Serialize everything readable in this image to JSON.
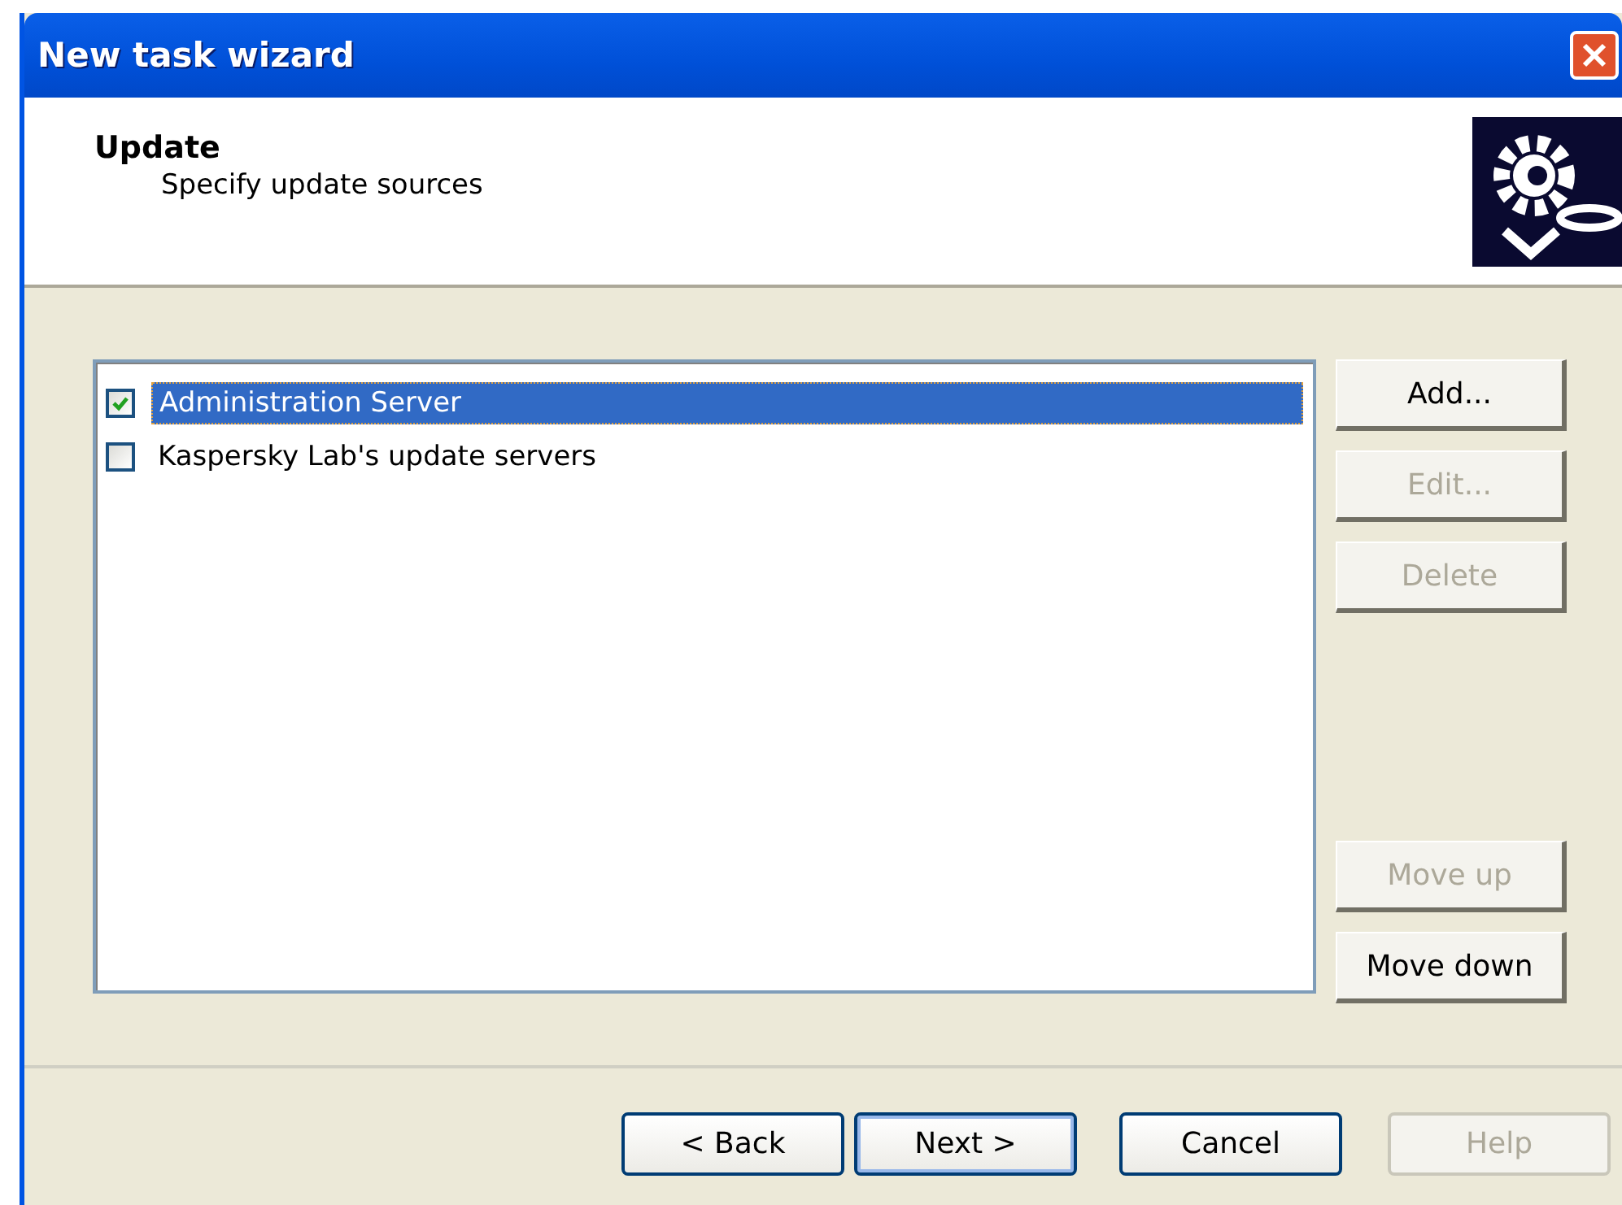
{
  "window": {
    "title": "New task wizard"
  },
  "header": {
    "title": "Update",
    "subtitle": "Specify update sources"
  },
  "sources": [
    {
      "label": "Administration Server",
      "checked": true,
      "selected": true
    },
    {
      "label": "Kaspersky Lab's update servers",
      "checked": false,
      "selected": false
    }
  ],
  "side_buttons": [
    {
      "label": "Add...",
      "disabled": false
    },
    {
      "label": "Edit...",
      "disabled": true
    },
    {
      "label": "Delete",
      "disabled": true
    }
  ],
  "order_buttons": [
    {
      "label": "Move up",
      "disabled": true
    },
    {
      "label": "Move down",
      "disabled": false
    }
  ],
  "footer_buttons": [
    {
      "label": "< Back",
      "disabled": false,
      "default": false
    },
    {
      "label": "Next >",
      "disabled": false,
      "default": true
    },
    {
      "label": "Cancel",
      "disabled": false,
      "default": false
    },
    {
      "label": "Help",
      "disabled": true,
      "default": false
    }
  ]
}
